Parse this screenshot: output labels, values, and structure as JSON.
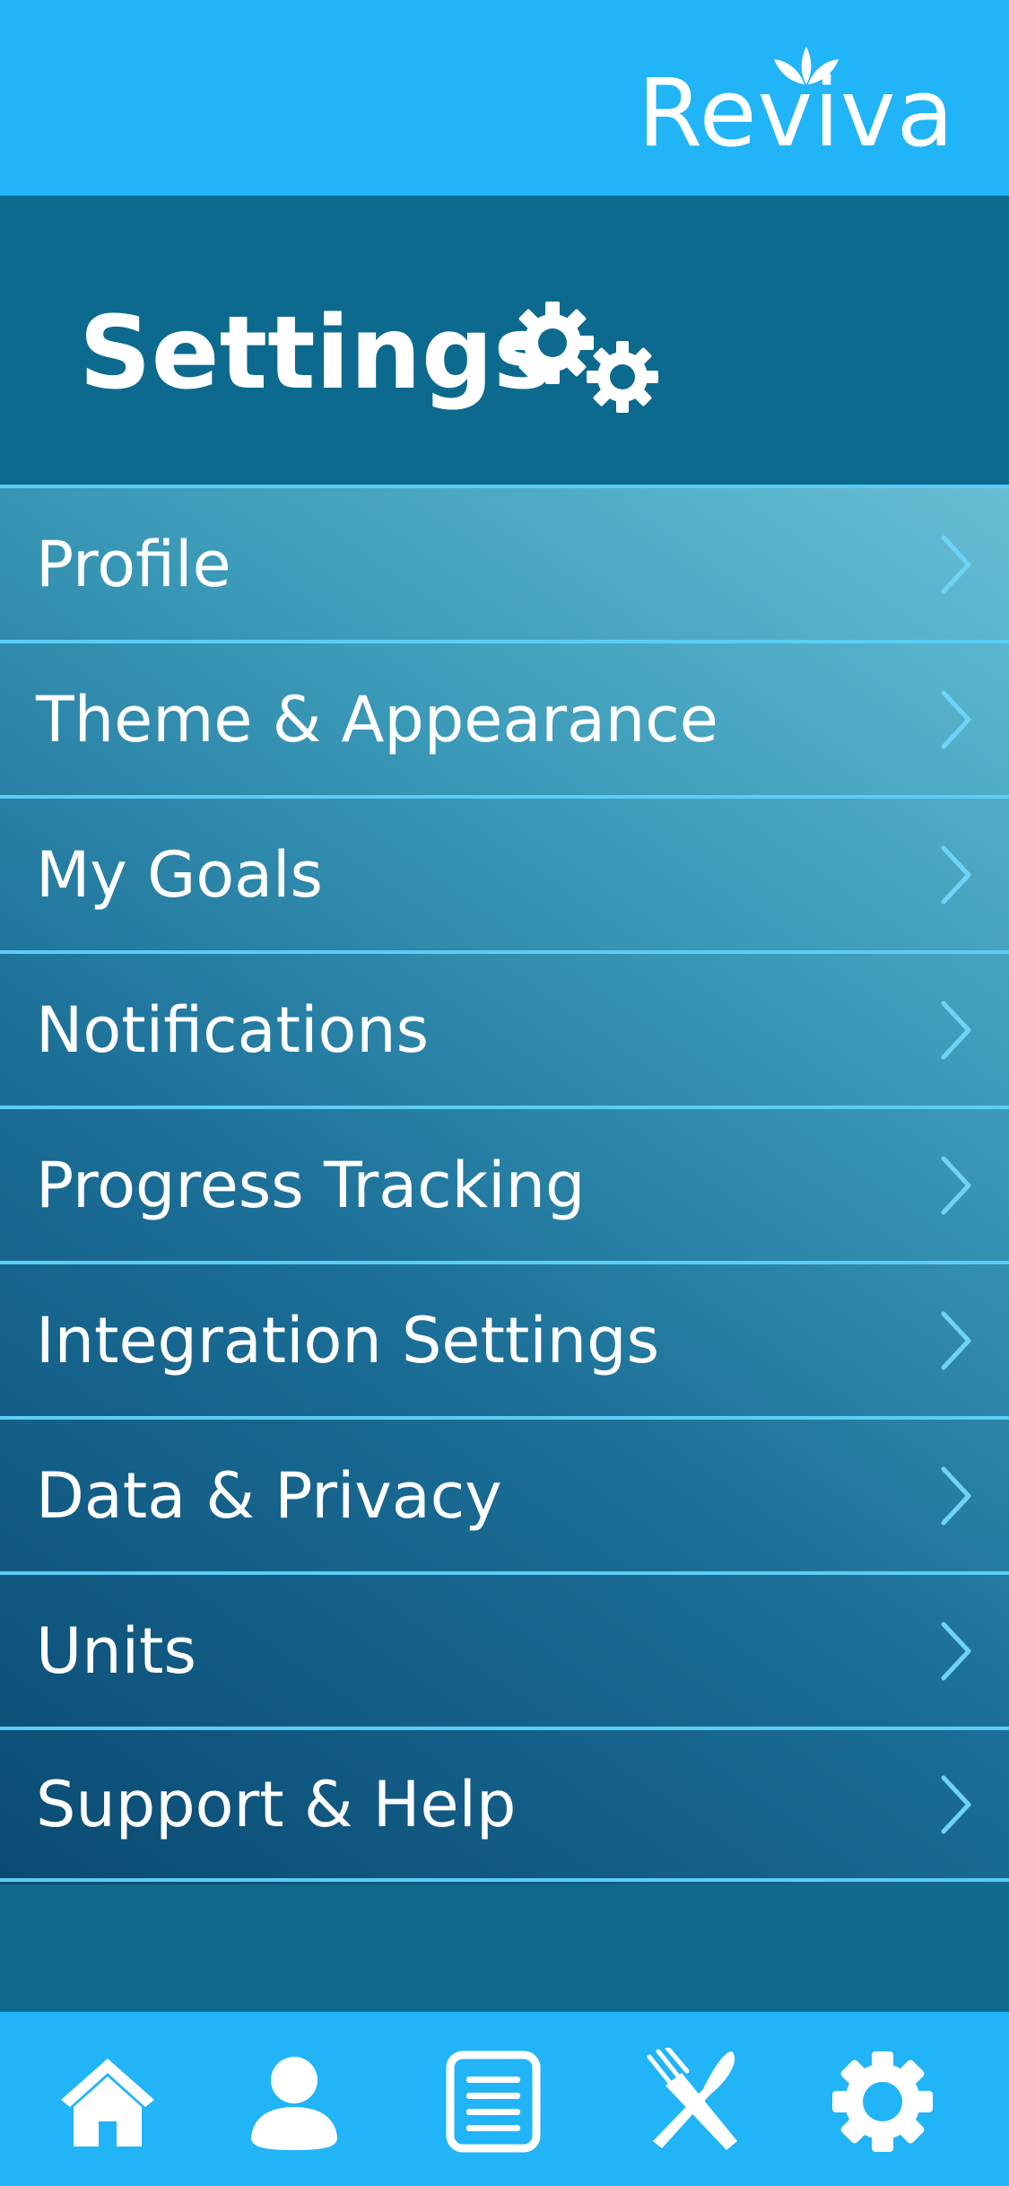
{
  "app": {
    "logo_text": "Reviva",
    "accent_color": "#21b4f7",
    "header_color": "#0c6a8e",
    "divider_color": "#5ccdf4"
  },
  "page": {
    "title": "Settings",
    "title_icon": "gears-icon"
  },
  "menu": {
    "items": [
      {
        "label": "Profile",
        "icon": "chevron-right-icon"
      },
      {
        "label": "Theme & Appearance",
        "icon": "chevron-right-icon"
      },
      {
        "label": "My Goals",
        "icon": "chevron-right-icon"
      },
      {
        "label": "Notifications",
        "icon": "chevron-right-icon"
      },
      {
        "label": "Progress Tracking",
        "icon": "chevron-right-icon"
      },
      {
        "label": "Integration Settings",
        "icon": "chevron-right-icon"
      },
      {
        "label": "Data & Privacy",
        "icon": "chevron-right-icon"
      },
      {
        "label": "Units",
        "icon": "chevron-right-icon"
      },
      {
        "label": "Support & Help",
        "icon": "chevron-right-icon"
      }
    ]
  },
  "bottom_nav": {
    "items": [
      {
        "icon": "home-icon"
      },
      {
        "icon": "user-icon"
      },
      {
        "icon": "list-icon"
      },
      {
        "icon": "fork-knife-icon"
      },
      {
        "icon": "gear-icon",
        "active": true
      }
    ]
  }
}
